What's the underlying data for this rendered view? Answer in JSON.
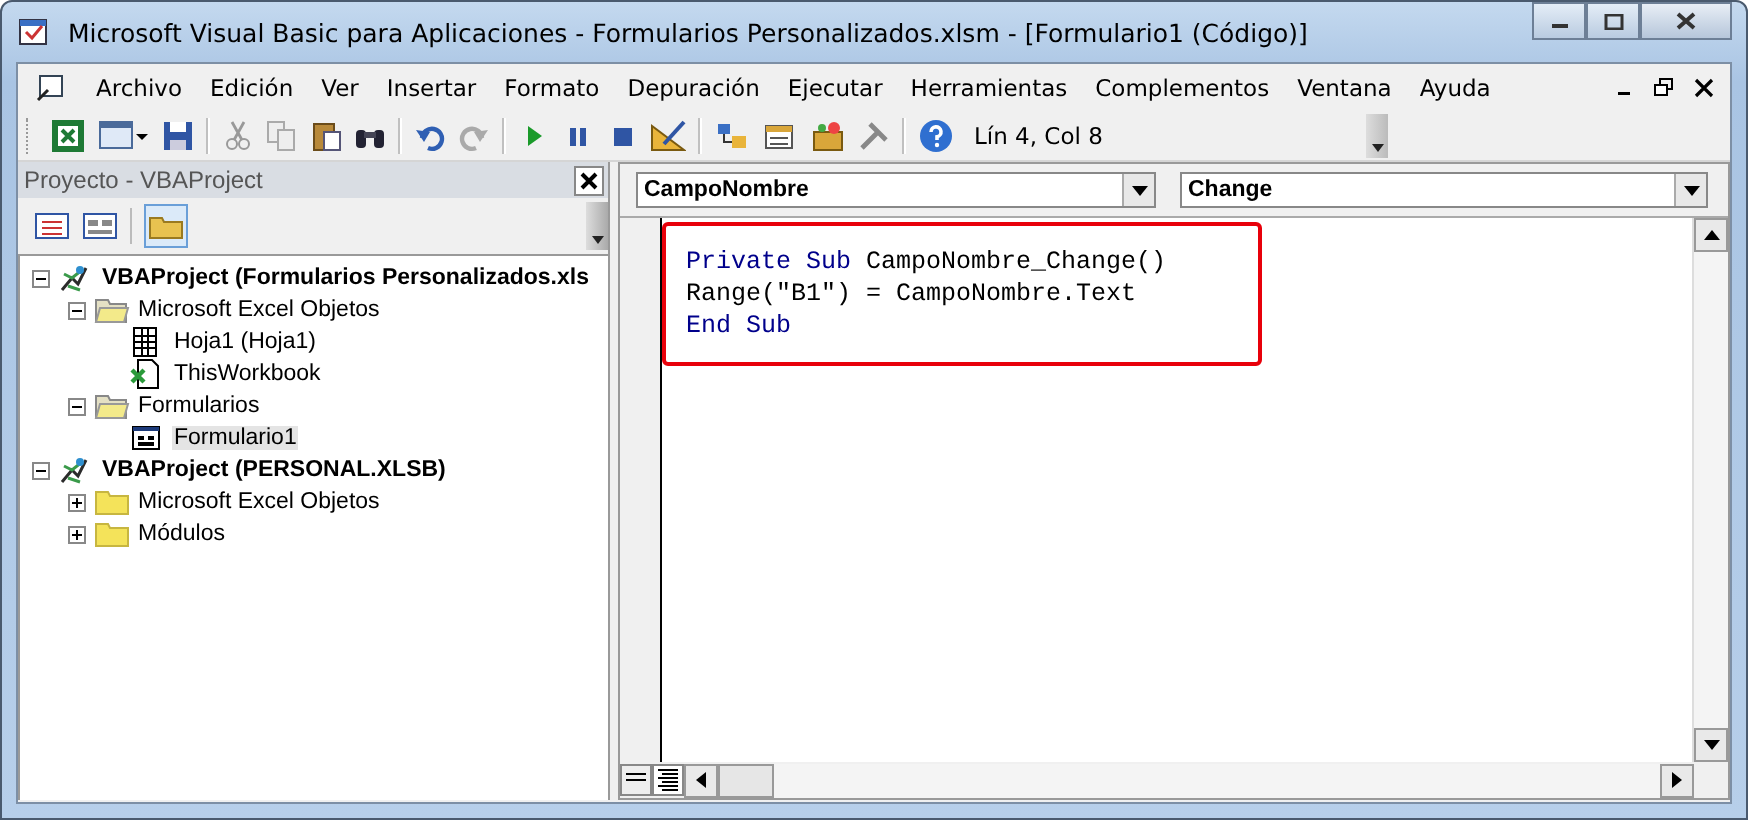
{
  "window": {
    "title": "Microsoft Visual Basic para Aplicaciones - Formularios Personalizados.xlsm - [Formulario1 (Código)]"
  },
  "menu": [
    "Archivo",
    "Edición",
    "Ver",
    "Insertar",
    "Formato",
    "Depuración",
    "Ejecutar",
    "Herramientas",
    "Complementos",
    "Ventana",
    "Ayuda"
  ],
  "toolbar": {
    "position": "Lín 4, Col 8"
  },
  "project_panel": {
    "title": "Proyecto - VBAProject",
    "tree": [
      {
        "label": "VBAProject (Formularios Personalizados.xls",
        "kind": "project",
        "expanded": true,
        "selected": false,
        "children": [
          {
            "label": "Microsoft Excel Objetos",
            "kind": "folder",
            "expanded": true,
            "selected": false,
            "children": [
              {
                "label": "Hoja1 (Hoja1)",
                "kind": "sheet",
                "selected": false
              },
              {
                "label": "ThisWorkbook",
                "kind": "workbook",
                "selected": false
              }
            ]
          },
          {
            "label": "Formularios",
            "kind": "folder",
            "expanded": true,
            "selected": false,
            "children": [
              {
                "label": "Formulario1",
                "kind": "form",
                "selected": true
              }
            ]
          }
        ]
      },
      {
        "label": "VBAProject (PERSONAL.XLSB)",
        "kind": "project",
        "expanded": true,
        "selected": false,
        "children": [
          {
            "label": "Microsoft Excel Objetos",
            "kind": "folder",
            "expanded": false,
            "selected": false
          },
          {
            "label": "Módulos",
            "kind": "folder",
            "expanded": false,
            "selected": false
          }
        ]
      }
    ]
  },
  "code_window": {
    "object": "CampoNombre",
    "procedure": "Change",
    "lines": [
      [
        {
          "text": "Private Sub",
          "kind": "keyword"
        },
        {
          "text": " CampoNombre_Change()",
          "kind": "plain"
        }
      ],
      [
        {
          "text": "Range(\"B1\") = CampoNombre.Text",
          "kind": "plain"
        }
      ],
      [
        {
          "text": "End Sub",
          "kind": "keyword"
        }
      ]
    ]
  }
}
